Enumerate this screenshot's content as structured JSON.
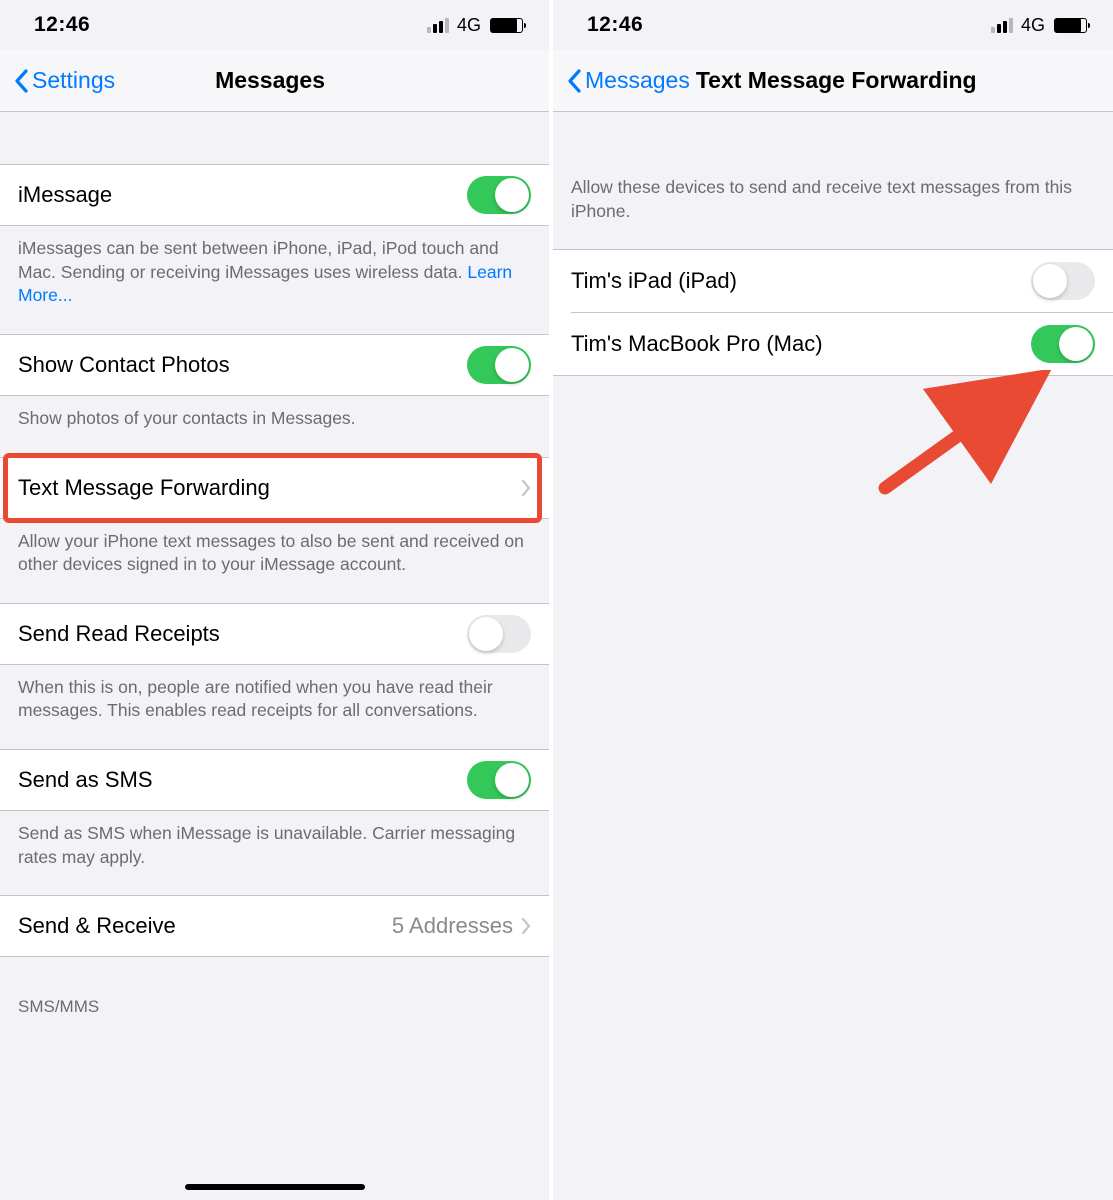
{
  "status": {
    "time": "12:46",
    "network": "4G"
  },
  "left": {
    "back": "Settings",
    "title": "Messages",
    "rows": {
      "imessage": {
        "label": "iMessage",
        "on": true,
        "footer": "iMessages can be sent between iPhone, iPad, iPod touch and Mac. Sending or receiving iMessages uses wireless data. ",
        "learn": "Learn More..."
      },
      "contacts": {
        "label": "Show Contact Photos",
        "on": true,
        "footer": "Show photos of your contacts in Messages."
      },
      "forwarding": {
        "label": "Text Message Forwarding",
        "footer": "Allow your iPhone text messages to also be sent and received on other devices signed in to your iMessage account."
      },
      "receipts": {
        "label": "Send Read Receipts",
        "on": false,
        "footer": "When this is on, people are notified when you have read their messages. This enables read receipts for all conversations."
      },
      "sms": {
        "label": "Send as SMS",
        "on": true,
        "footer": "Send as SMS when iMessage is unavailable. Carrier messaging rates may apply."
      },
      "sr": {
        "label": "Send & Receive",
        "detail": "5 Addresses"
      },
      "section": "SMS/MMS"
    }
  },
  "right": {
    "back": "Messages",
    "title": "Text Message Forwarding",
    "header": "Allow these devices to send and receive text messages from this iPhone.",
    "devices": [
      {
        "label": "Tim's iPad (iPad)",
        "on": false
      },
      {
        "label": "Tim's MacBook Pro (Mac)",
        "on": true
      }
    ]
  }
}
